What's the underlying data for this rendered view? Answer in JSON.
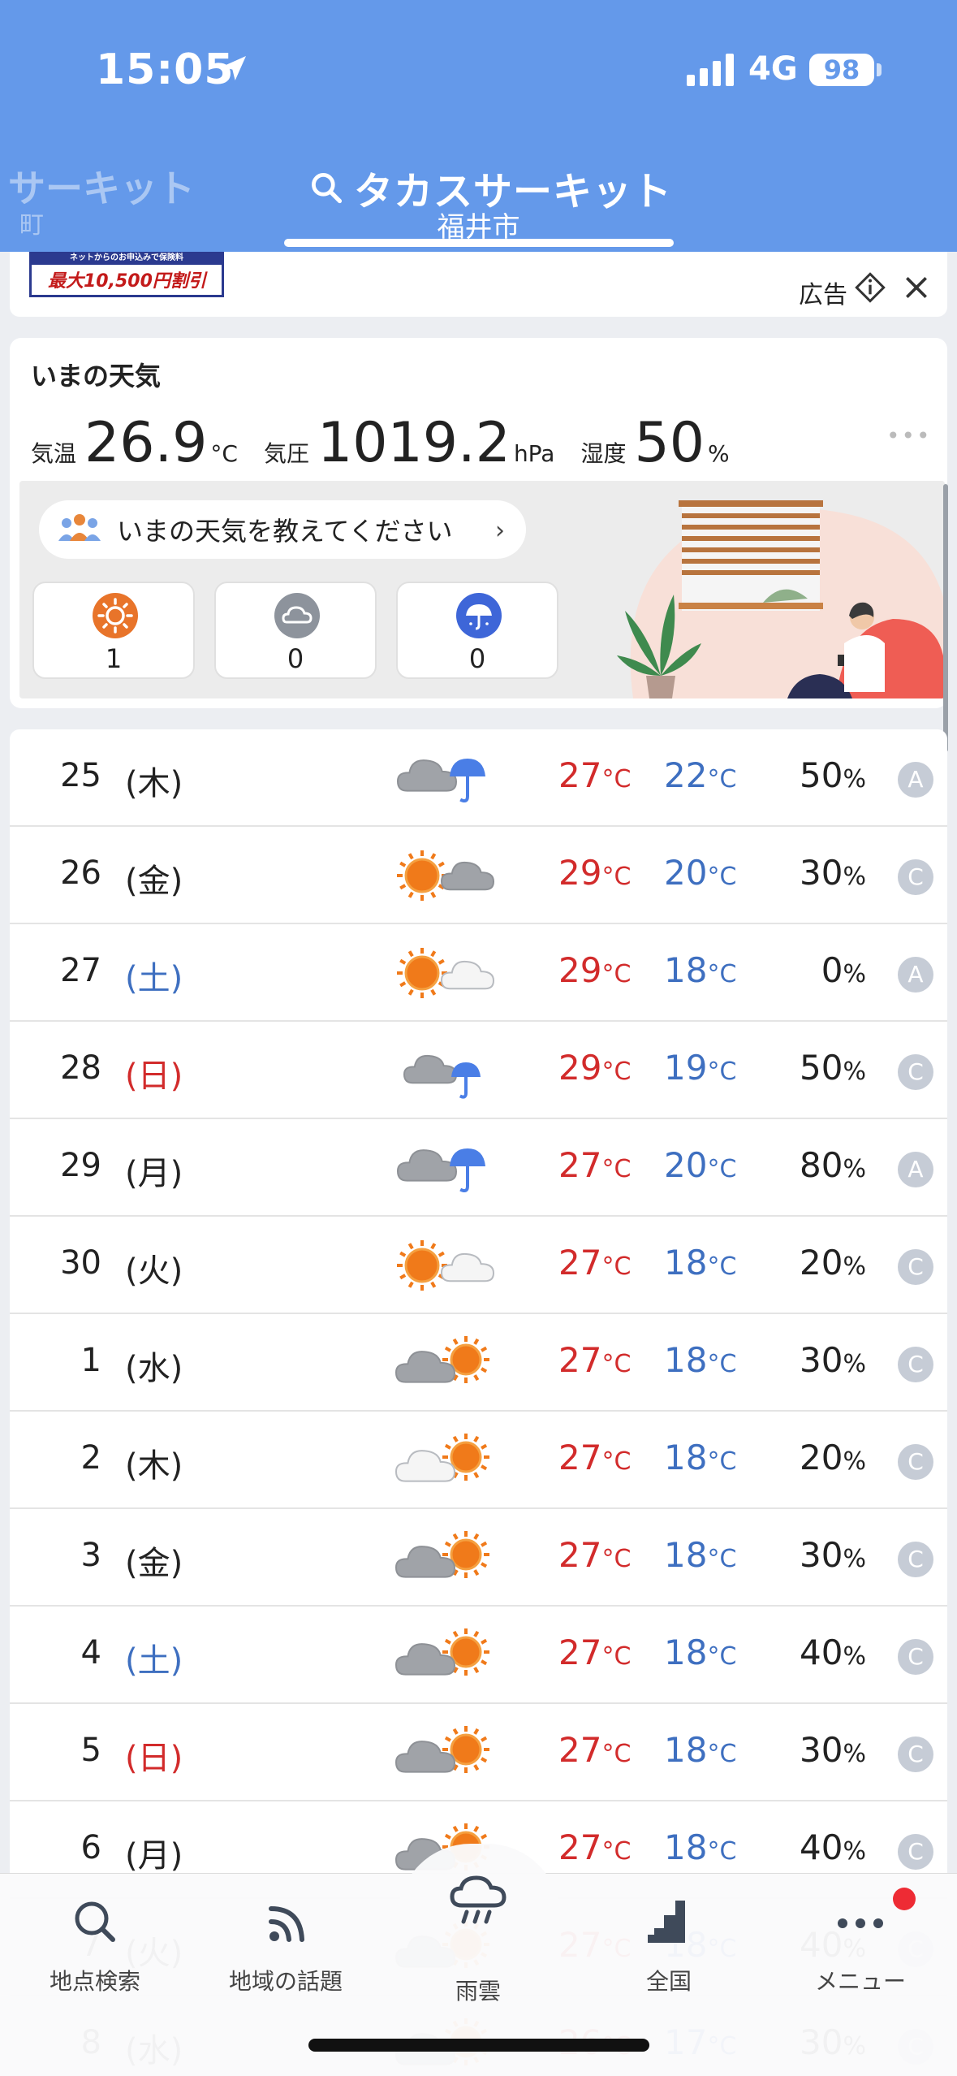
{
  "status_bar": {
    "time": "15:05",
    "network": "4G",
    "battery": "98"
  },
  "header": {
    "prev_location": "サーキット",
    "prev_location_sub": "町",
    "title": "タカスサーキット",
    "subtitle": "福井市"
  },
  "ad": {
    "label": "広告",
    "banner_top": "ネットからのお申込みで保険料",
    "banner_main": "最大10,500円割引"
  },
  "current": {
    "title": "いまの天気",
    "temp_label": "気温",
    "temp_value": "26.9",
    "temp_unit": "°C",
    "pressure_label": "気圧",
    "pressure_value": "1019.2",
    "pressure_unit": "hPa",
    "humidity_label": "湿度",
    "humidity_value": "50",
    "humidity_unit": "%",
    "more": "•••",
    "report_prompt": "いまの天気を教えてください",
    "votes": [
      {
        "kind": "sunny",
        "count": "1"
      },
      {
        "kind": "cloudy",
        "count": "0"
      },
      {
        "kind": "rainy",
        "count": "0"
      }
    ]
  },
  "forecast": [
    {
      "day": "25",
      "weekday": "(木)",
      "icon": "cloud-rain",
      "high": "27",
      "low": "22",
      "pop": "50",
      "rel": "A"
    },
    {
      "day": "26",
      "weekday": "(金)",
      "icon": "sun-cloud",
      "high": "29",
      "low": "20",
      "pop": "30",
      "rel": "C"
    },
    {
      "day": "27",
      "weekday": "(土)",
      "icon": "sun-lightcloud",
      "high": "29",
      "low": "18",
      "pop": "0",
      "rel": "A"
    },
    {
      "day": "28",
      "weekday": "(日)",
      "icon": "cloud-rain-small",
      "high": "29",
      "low": "19",
      "pop": "50",
      "rel": "C"
    },
    {
      "day": "29",
      "weekday": "(月)",
      "icon": "cloud-rain",
      "high": "27",
      "low": "20",
      "pop": "80",
      "rel": "A"
    },
    {
      "day": "30",
      "weekday": "(火)",
      "icon": "sun-lightcloud",
      "high": "27",
      "low": "18",
      "pop": "20",
      "rel": "C"
    },
    {
      "day": "1",
      "weekday": "(水)",
      "icon": "cloud-sun",
      "high": "27",
      "low": "18",
      "pop": "30",
      "rel": "C"
    },
    {
      "day": "2",
      "weekday": "(木)",
      "icon": "lightcloud-sun",
      "high": "27",
      "low": "18",
      "pop": "20",
      "rel": "C"
    },
    {
      "day": "3",
      "weekday": "(金)",
      "icon": "cloud-sun",
      "high": "27",
      "low": "18",
      "pop": "30",
      "rel": "C"
    },
    {
      "day": "4",
      "weekday": "(土)",
      "icon": "cloud-sun",
      "high": "27",
      "low": "18",
      "pop": "40",
      "rel": "C"
    },
    {
      "day": "5",
      "weekday": "(日)",
      "icon": "cloud-sun",
      "high": "27",
      "low": "18",
      "pop": "30",
      "rel": "C"
    },
    {
      "day": "6",
      "weekday": "(月)",
      "icon": "cloud-sun",
      "high": "27",
      "low": "18",
      "pop": "40",
      "rel": "C"
    },
    {
      "day": "7",
      "weekday": "(火)",
      "icon": "cloud-sun",
      "high": "27",
      "low": "18",
      "pop": "40",
      "rel": "C"
    },
    {
      "day": "8",
      "weekday": "(水)",
      "icon": "cloud-sun",
      "high": "26",
      "low": "17",
      "pop": "30",
      "rel": "C"
    }
  ],
  "temp_unit_small": "°C",
  "pop_unit": "%",
  "tabs": [
    {
      "label": "地点検索",
      "icon": "search-icon"
    },
    {
      "label": "地域の話題",
      "icon": "feed-icon"
    },
    {
      "label": "雨雲",
      "icon": "rain-cloud-icon"
    },
    {
      "label": "全国",
      "icon": "map-bars-icon"
    },
    {
      "label": "メニュー",
      "icon": "more-icon"
    }
  ],
  "colors": {
    "header": "#6499ea",
    "high_temp": "#d22b2b",
    "low_temp": "#3e6fc0",
    "sun": "#f07a1a"
  }
}
